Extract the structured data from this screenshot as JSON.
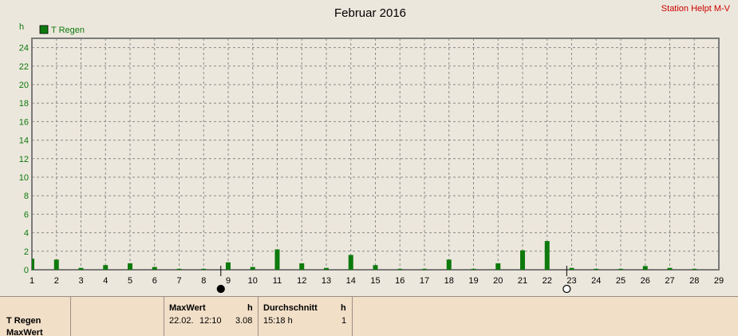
{
  "station_label": "Station Helpt M-V",
  "colors": {
    "series": "#0d7a0d",
    "axis_text": "#0d7a0d",
    "station_text": "#cc0000",
    "grid": "#8a8a8a"
  },
  "chart_data": {
    "type": "bar",
    "title": "Februar 2016",
    "ylabel": "h",
    "ylim": [
      0,
      25
    ],
    "yticks": [
      0,
      2,
      4,
      6,
      8,
      10,
      12,
      14,
      16,
      18,
      20,
      22,
      24
    ],
    "xlim": [
      1,
      29
    ],
    "xticks": [
      1,
      2,
      3,
      4,
      5,
      6,
      7,
      8,
      9,
      10,
      11,
      12,
      13,
      14,
      15,
      16,
      17,
      18,
      19,
      20,
      21,
      22,
      23,
      24,
      25,
      26,
      27,
      28,
      29
    ],
    "grid": true,
    "legend_position": "top-left",
    "series": [
      {
        "name": "T Regen",
        "x": [
          1,
          2,
          3,
          4,
          5,
          6,
          7,
          8,
          9,
          10,
          11,
          12,
          13,
          14,
          15,
          16,
          17,
          18,
          19,
          20,
          21,
          22,
          23,
          24,
          25,
          26,
          27,
          28
        ],
        "values": [
          1.2,
          1.1,
          0.2,
          0.5,
          0.7,
          0.3,
          0.1,
          0.1,
          0.8,
          0.3,
          2.2,
          0.7,
          0.2,
          1.6,
          0.5,
          0.1,
          0.1,
          1.1,
          0.1,
          0.7,
          2.1,
          3.1,
          0.2,
          0.1,
          0.1,
          0.4,
          0.2,
          0.1
        ]
      }
    ],
    "moon_markers": [
      {
        "phase": "new-moon",
        "x": 8.7
      },
      {
        "phase": "full-moon",
        "x": 22.8
      }
    ]
  },
  "panel": {
    "row_label": "T Regen",
    "row_label_2": "MaxWert",
    "max_header": "MaxWert",
    "max_unit": "h",
    "max_date": "22.02.",
    "max_time": "12:10",
    "max_value": "3.08",
    "avg_header": "Durchschnitt",
    "avg_unit": "h",
    "avg_value": "15:18 h",
    "avg_count": "1"
  }
}
